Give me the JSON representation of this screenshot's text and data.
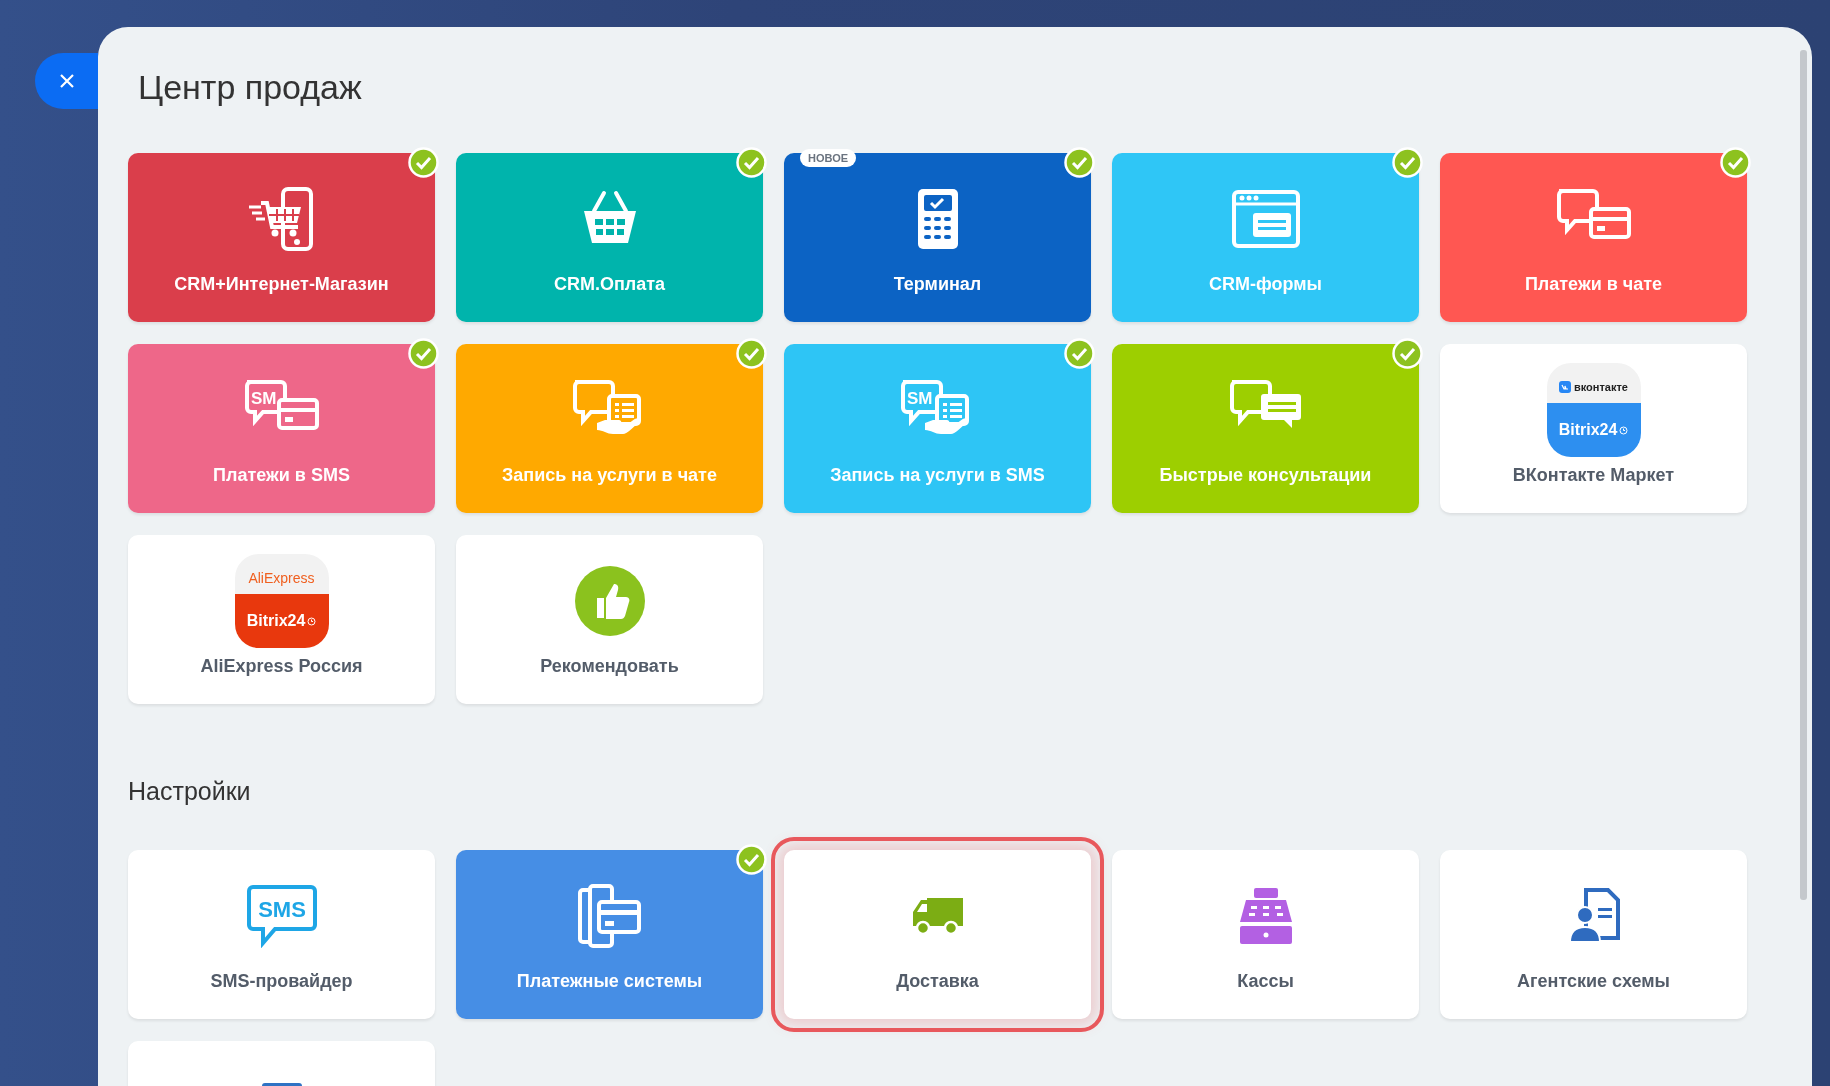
{
  "title": "Центр продаж",
  "apps": [
    {
      "label": "CRM+Интернет-Магазин",
      "kind": "filled",
      "color": "#da3e4b",
      "checked": true
    },
    {
      "label": "CRM.Оплата",
      "kind": "filled",
      "color": "#00b4ac",
      "checked": true
    },
    {
      "label": "Терминал",
      "kind": "filled",
      "color": "#0c63c4",
      "checked": true,
      "badge": "НОВОЕ"
    },
    {
      "label": "CRM-формы",
      "kind": "filled",
      "color": "#2fc6f6",
      "checked": true
    },
    {
      "label": "Платежи в чате",
      "kind": "filled",
      "color": "#ff5752",
      "checked": true
    },
    {
      "label": "Платежи в SMS",
      "kind": "filled",
      "color": "#ee6789",
      "checked": true,
      "icon_text": "SM"
    },
    {
      "label": "Запись на услуги в чате",
      "kind": "filled",
      "color": "#ffa900",
      "checked": true
    },
    {
      "label": "Запись на услуги в SMS",
      "kind": "filled",
      "color": "#2ec5f5",
      "checked": true,
      "icon_text": "SM"
    },
    {
      "label": "Быстрые консультации",
      "kind": "filled",
      "color": "#9dcf00",
      "checked": true
    },
    {
      "label": "ВКонтакте Маркет",
      "kind": "plain",
      "color": "#ffffff",
      "checked": false,
      "logo": {
        "kind": "vk",
        "top": "вконтакте",
        "bottom": "Bitrix24"
      }
    },
    {
      "label": "AliExpress Россия",
      "kind": "plain",
      "color": "#ffffff",
      "checked": false,
      "logo": {
        "kind": "aliexpress",
        "top": "AliExpress",
        "bottom": "Bitrix24"
      }
    },
    {
      "label": "Рекомендовать",
      "kind": "plain",
      "color": "#ffffff",
      "checked": false
    }
  ],
  "settings": {
    "heading": "Настройки",
    "tiles": [
      {
        "label": "SMS-провайдер",
        "kind": "plain",
        "color": "#ffffff",
        "checked": false,
        "highlighted": false,
        "icon_text": "SMS"
      },
      {
        "label": "Платежные системы",
        "kind": "filled",
        "color": "#468ee5",
        "checked": true,
        "highlighted": false
      },
      {
        "label": "Доставка",
        "kind": "plain",
        "color": "#ffffff",
        "checked": false,
        "highlighted": true
      },
      {
        "label": "Кассы",
        "kind": "plain",
        "color": "#ffffff",
        "checked": false,
        "highlighted": false
      },
      {
        "label": "Агентские схемы",
        "kind": "plain",
        "color": "#ffffff",
        "checked": false,
        "highlighted": false
      },
      {
        "kind": "plain",
        "color": "#ffffff",
        "checked": false,
        "highlighted": false
      }
    ]
  }
}
